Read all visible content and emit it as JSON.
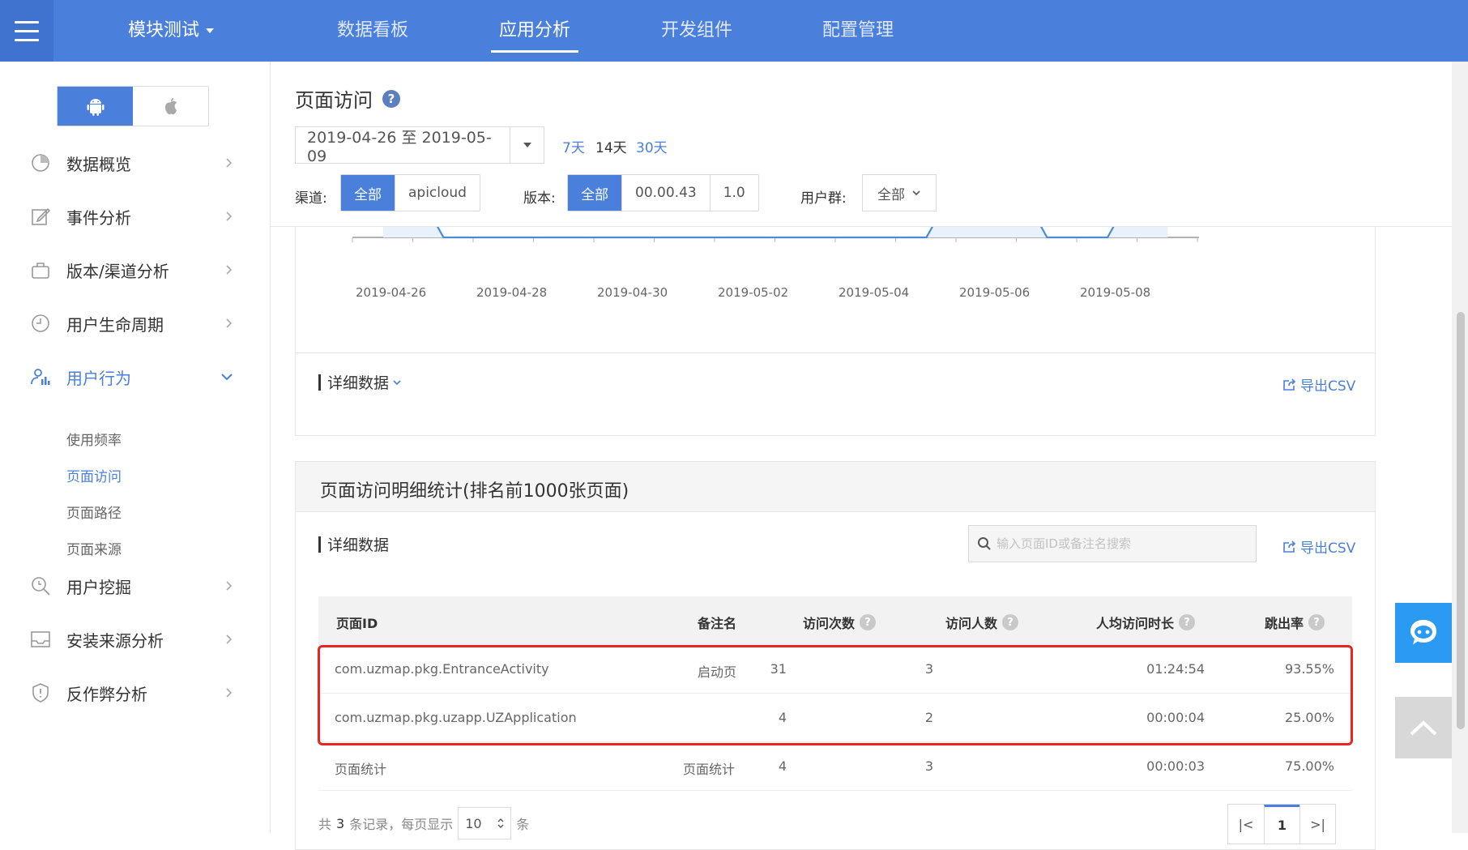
{
  "topnav": {
    "module_title": "模块测试",
    "items": [
      "数据看板",
      "应用分析",
      "开发组件",
      "配置管理"
    ],
    "active_index": 1,
    "color": "#4a7fdb"
  },
  "sidebar": {
    "os_toggle": {
      "android_icon": "android-icon",
      "apple_icon": "apple-icon",
      "active": "android"
    },
    "items": [
      {
        "label": "数据概览",
        "icon": "pie-chart-icon"
      },
      {
        "label": "事件分析",
        "icon": "edit-icon"
      },
      {
        "label": "版本/渠道分析",
        "icon": "bag-icon"
      },
      {
        "label": "用户生命周期",
        "icon": "clock-icon"
      },
      {
        "label": "用户行为",
        "icon": "user-chart-icon"
      },
      {
        "label": "用户挖掘",
        "icon": "magnifier-icon"
      },
      {
        "label": "安装来源分析",
        "icon": "inbox-icon"
      },
      {
        "label": "反作弊分析",
        "icon": "shield-icon"
      }
    ],
    "active_item": "用户行为",
    "sub_items": [
      "使用频率",
      "页面访问",
      "页面路径",
      "页面来源"
    ],
    "active_sub": "页面访问"
  },
  "header": {
    "title": "页面访问",
    "help_icon": "question-icon",
    "date_range": "2019-04-26 至 2019-05-09",
    "quick_ranges": [
      "7天",
      "14天",
      "30天"
    ],
    "channel_label": "渠道:",
    "channel_options": [
      "全部",
      "apicloud"
    ],
    "version_label": "版本:",
    "version_options": [
      "全部",
      "00.00.43",
      "1.0"
    ],
    "usergroup_label": "用户群:",
    "usergroup_value": "全部"
  },
  "chart_data": {
    "type": "area",
    "x": [
      "2019-04-26",
      "2019-04-27",
      "2019-04-28",
      "2019-04-29",
      "2019-04-30",
      "2019-05-01",
      "2019-05-02",
      "2019-05-03",
      "2019-05-04",
      "2019-05-05",
      "2019-05-06",
      "2019-05-07",
      "2019-05-08",
      "2019-05-09"
    ],
    "x_tick_labels": [
      "2019-04-26",
      "2019-04-28",
      "2019-04-30",
      "2019-05-02",
      "2019-05-04",
      "2019-05-06",
      "2019-05-08"
    ],
    "series": [
      {
        "values": [
          null,
          0,
          0,
          0,
          0,
          0,
          0,
          0,
          0,
          0,
          null,
          0,
          0,
          null
        ]
      }
    ],
    "xlabel": "",
    "ylabel": "",
    "color": "#4a8ad6",
    "fill": "#e9f1fc",
    "grid": false
  },
  "detail_section": {
    "label": "详细数据",
    "export": "导出CSV"
  },
  "table_section": {
    "title": "页面访问明细统计(排名前1000张页面)",
    "label": "详细数据",
    "export": "导出CSV",
    "search_placeholder": "输入页面ID或备注名搜索",
    "columns": [
      "页面ID",
      "备注名",
      "访问次数",
      "访问人数",
      "人均访问时长",
      "跳出率"
    ],
    "rows": [
      [
        "com.uzmap.pkg.EntranceActivity",
        "启动页",
        "31",
        "3",
        "01:24:54",
        "93.55%"
      ],
      [
        "com.uzmap.pkg.uzapp.UZApplication",
        "",
        "4",
        "2",
        "00:00:04",
        "25.00%"
      ],
      [
        "页面统计",
        "页面统计",
        "4",
        "3",
        "00:00:03",
        "75.00%"
      ]
    ],
    "footer_prefix": "共",
    "footer_count": "3",
    "footer_mid": "条记录，每页显示",
    "page_size": "10",
    "footer_suffix": "条",
    "pager": [
      "|<",
      "1",
      ">|"
    ],
    "current_page": "1",
    "highlight_color": "#e8261f"
  },
  "floating": {
    "chat_icon": "chat-bot-icon",
    "top_icon": "back-to-top-icon",
    "chat_color": "#2b9af3"
  }
}
